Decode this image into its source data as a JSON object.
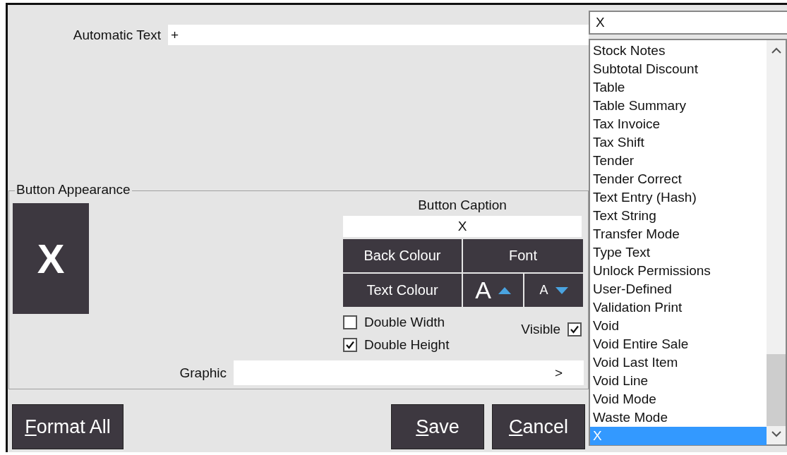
{
  "automatic_text": {
    "label": "Automatic Text",
    "value": "+"
  },
  "button_appearance": {
    "title": "Button Appearance",
    "preview_caption": "X",
    "caption_label": "Button Caption",
    "caption_value": "X",
    "style_buttons": [
      {
        "kind": "text",
        "label": "Back Colour"
      },
      {
        "kind": "text",
        "label": "Font"
      },
      {
        "kind": "text",
        "label": "Text Colour"
      },
      {
        "kind": "grow",
        "label": "A"
      },
      {
        "kind": "shrink",
        "label": "A"
      }
    ],
    "double_width": {
      "label": "Double Width",
      "checked": false
    },
    "double_height": {
      "label": "Double Height",
      "checked": true
    },
    "visible": {
      "label": "Visible",
      "checked": true
    },
    "graphic": {
      "label": "Graphic",
      "browse": ">"
    }
  },
  "buttons": [
    {
      "label": "Format All",
      "underline_first": true
    },
    {
      "label": "Save",
      "underline_first": true
    },
    {
      "label": "Cancel",
      "underline_first": true
    }
  ],
  "search": {
    "value": "X"
  },
  "function_list": [
    {
      "label": "Stock Notes",
      "selected": false
    },
    {
      "label": "Subtotal Discount",
      "selected": false
    },
    {
      "label": "Table",
      "selected": false
    },
    {
      "label": "Table Summary",
      "selected": false
    },
    {
      "label": "Tax Invoice",
      "selected": false
    },
    {
      "label": "Tax Shift",
      "selected": false
    },
    {
      "label": "Tender",
      "selected": false
    },
    {
      "label": "Tender Correct",
      "selected": false
    },
    {
      "label": "Text Entry (Hash)",
      "selected": false
    },
    {
      "label": "Text String",
      "selected": false
    },
    {
      "label": "Transfer Mode",
      "selected": false
    },
    {
      "label": "Type Text",
      "selected": false
    },
    {
      "label": "Unlock Permissions",
      "selected": false
    },
    {
      "label": "User-Defined",
      "selected": false
    },
    {
      "label": "Validation Print",
      "selected": false
    },
    {
      "label": "Void",
      "selected": false
    },
    {
      "label": "Void Entire Sale",
      "selected": false
    },
    {
      "label": "Void Last Item",
      "selected": false
    },
    {
      "label": "Void Line",
      "selected": false
    },
    {
      "label": "Void Mode",
      "selected": false
    },
    {
      "label": "Waste Mode",
      "selected": false
    },
    {
      "label": "X",
      "selected": true
    }
  ]
}
